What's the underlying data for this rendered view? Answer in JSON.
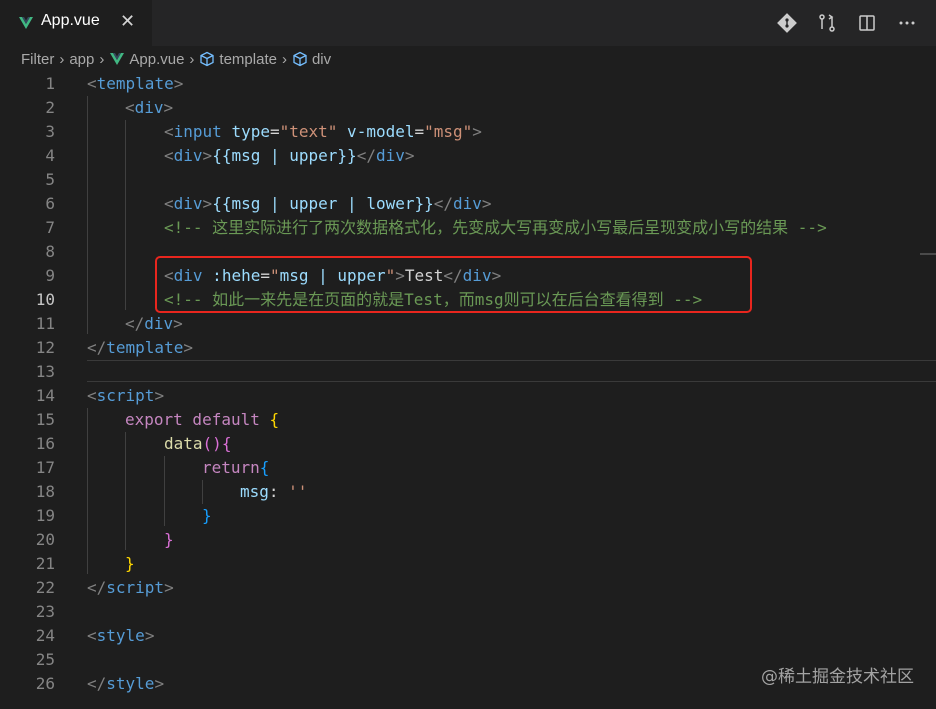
{
  "tab": {
    "label": "App.vue",
    "close": "✕"
  },
  "breadcrumb": {
    "items": [
      "Filter",
      "app",
      "App.vue",
      "template",
      "div"
    ]
  },
  "code": {
    "lines": [
      {
        "n": "1"
      },
      {
        "n": "2"
      },
      {
        "n": "3"
      },
      {
        "n": "4"
      },
      {
        "n": "5"
      },
      {
        "n": "6"
      },
      {
        "n": "7"
      },
      {
        "n": "8"
      },
      {
        "n": "9"
      },
      {
        "n": "10"
      },
      {
        "n": "11"
      },
      {
        "n": "12"
      },
      {
        "n": "13"
      },
      {
        "n": "14"
      },
      {
        "n": "15"
      },
      {
        "n": "16"
      },
      {
        "n": "17"
      },
      {
        "n": "18"
      },
      {
        "n": "19"
      },
      {
        "n": "20"
      },
      {
        "n": "21"
      },
      {
        "n": "22"
      },
      {
        "n": "23"
      },
      {
        "n": "24"
      },
      {
        "n": "25"
      },
      {
        "n": "26"
      }
    ],
    "l1": [
      "<",
      "template",
      ">"
    ],
    "l2": [
      "<",
      "div",
      ">"
    ],
    "l3": [
      "<",
      "input",
      " type",
      "=",
      "\"text\"",
      " v-model",
      "=",
      "\"msg\"",
      ">"
    ],
    "l4": [
      "<",
      "div",
      ">",
      "{{msg | upper}}",
      "</",
      "div",
      ">"
    ],
    "l6": [
      "<",
      "div",
      ">",
      "{{msg | upper | lower}}",
      "</",
      "div",
      ">"
    ],
    "l7": "<!-- 这里实际进行了两次数据格式化，先变成大写再变成小写最后呈现变成小写的结果 -->",
    "l9": [
      "<",
      "div",
      " :hehe",
      "=",
      "\"",
      "msg | upper",
      "\"",
      ">",
      "Test",
      "</",
      "div",
      ">"
    ],
    "l10": "<!-- 如此一来先是在页面的就是Test，而msg则可以在后台查看得到 -->",
    "l11": [
      "</",
      "div",
      ">"
    ],
    "l12": [
      "</",
      "template",
      ">"
    ],
    "l14": [
      "<",
      "script",
      ">"
    ],
    "l15": [
      "export",
      " default",
      " ",
      "{"
    ],
    "l16": [
      "data",
      "(",
      ")",
      "{"
    ],
    "l17": [
      "return",
      "{"
    ],
    "l18": [
      "msg",
      ": ",
      "''"
    ],
    "l19": "}",
    "l20": "}",
    "l21": "}",
    "l22": [
      "</",
      "script",
      ">"
    ],
    "l24": [
      "<",
      "style",
      ">"
    ],
    "l26": [
      "</",
      "style",
      ">"
    ]
  },
  "watermark": "@稀土掘金技术社区",
  "colors": {
    "tag": "#569cd6",
    "attr": "#9cdcfe",
    "string": "#ce9178",
    "comment": "#6a9955",
    "keyword": "#c586c0",
    "function": "#dcdcaa",
    "annotation_box": "#e8261e",
    "vue_logo": "#41b883"
  },
  "icons": [
    "vue-logo-icon",
    "close-icon",
    "source-control-icon",
    "compare-changes-icon",
    "split-editor-icon",
    "more-actions-icon",
    "chevron-right-icon",
    "cube-icon"
  ]
}
